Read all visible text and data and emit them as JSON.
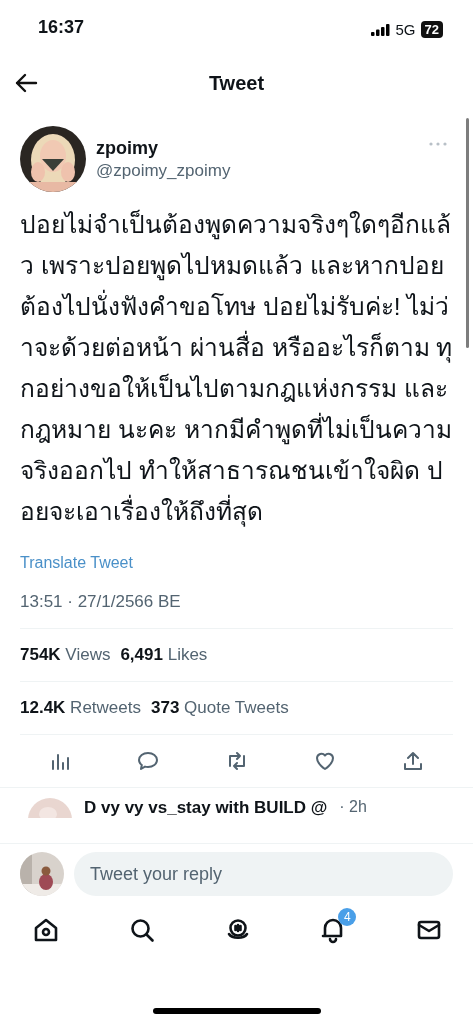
{
  "status_bar": {
    "time": "16:37",
    "network": "5G",
    "battery": "72"
  },
  "header": {
    "title": "Tweet"
  },
  "tweet": {
    "display_name": "zpoimy",
    "handle": "@zpoimy_zpoimy",
    "text": "ปอยไม่จำเป็นต้องพูดความจริงๆใดๆอีกแล้ว เพราะปอยพูดไปหมดแล้ว และหากปอยต้องไปนั่งฟังคำขอโทษ ปอยไม่รับค่ะ! ไม่ว่าจะด้วยต่อหน้า ผ่านสื่อ หรืออะไรก็ตาม ทุกอย่างขอให้เป็นไปตามกฎแห่งกรรม และ กฎหมาย นะคะ หากมีคำพูดที่ไม่เป็นความจริงออกไป ทำให้สาธารณชนเข้าใจผิด ปอยจะเอาเรื่องให้ถึงที่สุด",
    "translate_link": "Translate Tweet",
    "timestamp": "13:51 · 27/1/2566 BE",
    "stats": [
      [
        {
          "count": "754K",
          "label": "Views"
        },
        {
          "count": "6,491",
          "label": "Likes"
        }
      ],
      [
        {
          "count": "12.4K",
          "label": "Retweets"
        },
        {
          "count": "373",
          "label": "Quote Tweets"
        }
      ]
    ],
    "actions": [
      {
        "kind": "analytics"
      },
      {
        "kind": "reply"
      },
      {
        "kind": "retweet"
      },
      {
        "kind": "like"
      },
      {
        "kind": "share"
      }
    ]
  },
  "next_reply": {
    "author": "D vy vy vs_stay with BUILD @",
    "time": "· 2h"
  },
  "reply_bar": {
    "placeholder": "Tweet your reply"
  },
  "tab_bar": [
    {
      "kind": "home"
    },
    {
      "kind": "search"
    },
    {
      "kind": "spaces"
    },
    {
      "kind": "notifications",
      "badge": "4"
    },
    {
      "kind": "messages"
    }
  ]
}
